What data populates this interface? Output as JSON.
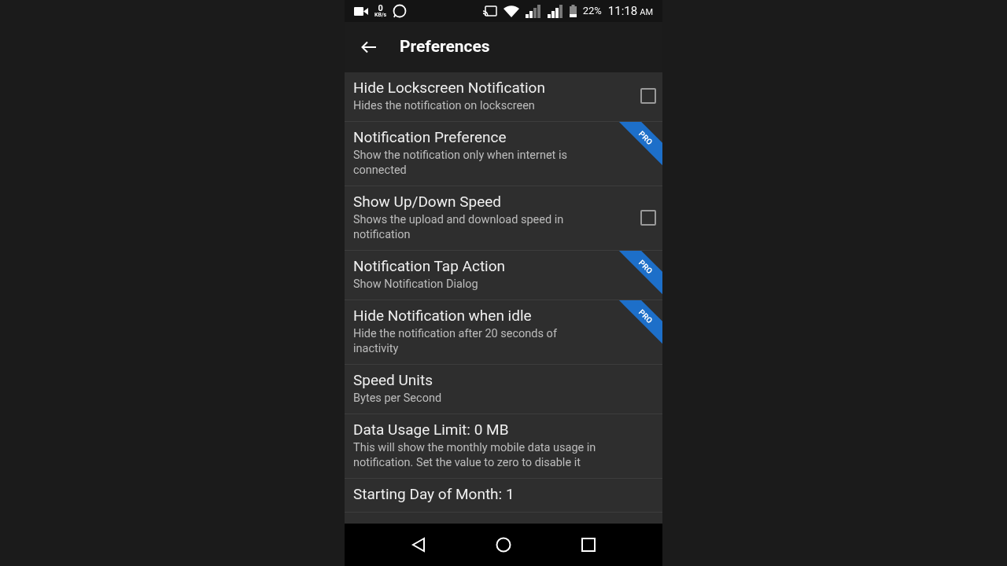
{
  "status_bar": {
    "net_speed": "0",
    "net_unit": "KB/s",
    "battery": "22%",
    "time": "11:18",
    "ampm": "AM"
  },
  "app_bar": {
    "title": "Preferences"
  },
  "preferences": [
    {
      "kind": "checkbox",
      "title": "Hide Lockscreen Notification",
      "summary": "Hides the notification on lockscreen",
      "checked": false
    },
    {
      "kind": "pro",
      "title": "Notification Preference",
      "summary": "Show the notification only when internet is connected",
      "badge": "PRO"
    },
    {
      "kind": "checkbox",
      "title": "Show Up/Down Speed",
      "summary": "Shows the upload and download speed in notification",
      "checked": false
    },
    {
      "kind": "pro",
      "title": "Notification Tap Action",
      "summary": "Show Notification Dialog",
      "badge": "PRO"
    },
    {
      "kind": "pro",
      "title": "Hide Notification when idle",
      "summary": "Hide the notification after 20 seconds of inactivity",
      "badge": "PRO"
    },
    {
      "kind": "plain",
      "title": "Speed Units",
      "summary": "Bytes per Second"
    },
    {
      "kind": "plain",
      "title": "Data Usage Limit: 0 MB",
      "summary": "This will show the monthly mobile data usage in notification. Set the value to zero to disable it"
    },
    {
      "kind": "plain",
      "title": "Starting Day of Month: 1"
    }
  ]
}
